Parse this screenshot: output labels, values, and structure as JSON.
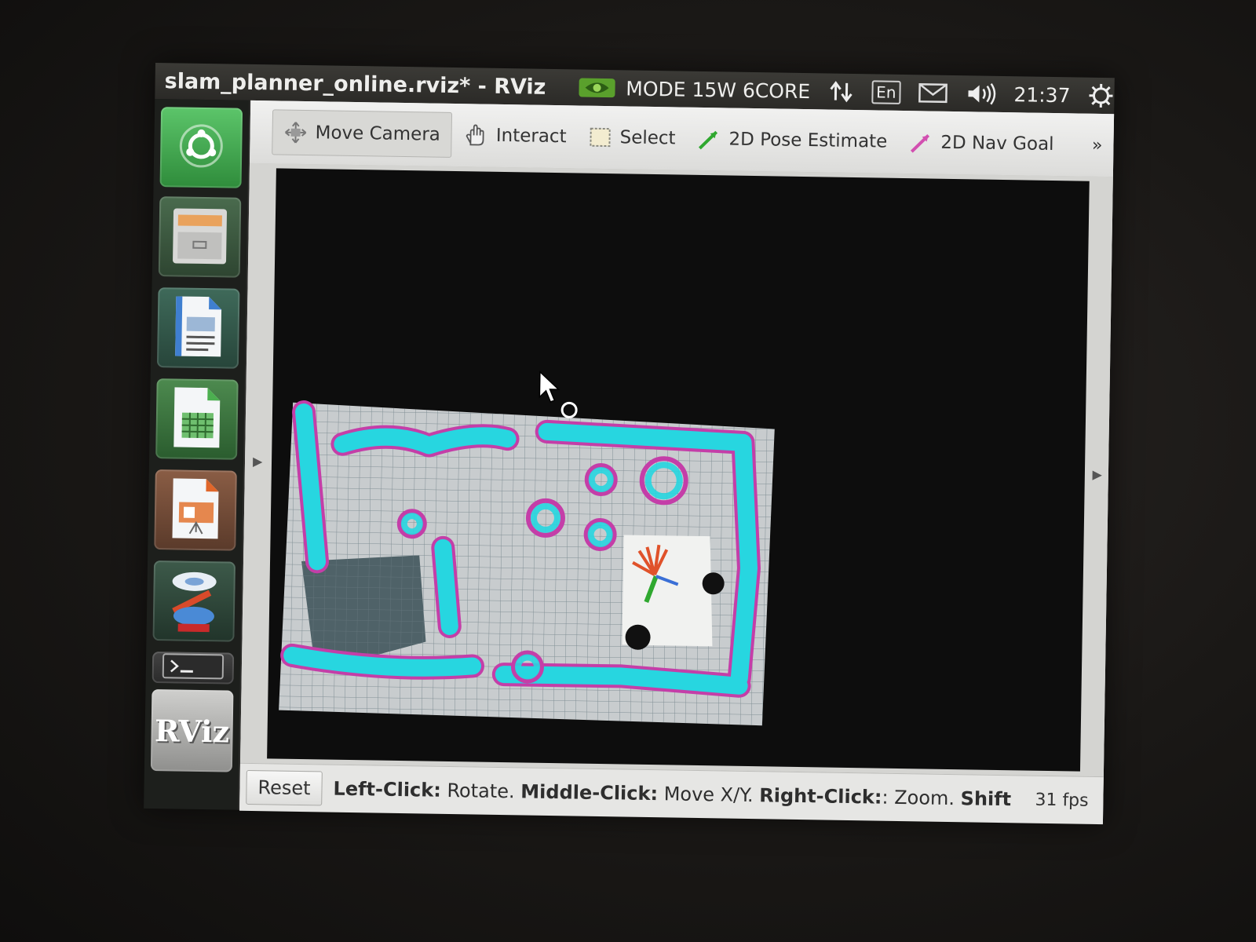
{
  "top_panel": {
    "window_title": "slam_planner_online.rviz* - RViz",
    "power_mode": "MODE 15W 6CORE",
    "keyboard_layout": "En",
    "clock": "21:37",
    "icons": [
      "nvidia-logo-icon",
      "network-arrows-icon",
      "mail-icon",
      "volume-icon",
      "power-gear-icon"
    ]
  },
  "launcher": {
    "items": [
      {
        "name": "dash-home",
        "icon": "ubuntu-logo-icon"
      },
      {
        "name": "files",
        "icon": "file-cabinet-icon"
      },
      {
        "name": "writer",
        "icon": "writer-document-icon"
      },
      {
        "name": "calc",
        "icon": "calc-spreadsheet-icon"
      },
      {
        "name": "impress",
        "icon": "impress-presentation-icon"
      },
      {
        "name": "software-center",
        "icon": "stacked-app-icon"
      },
      {
        "name": "terminal",
        "icon": "terminal-icon"
      },
      {
        "name": "rviz",
        "label": "RViz",
        "icon": "rviz-icon"
      }
    ]
  },
  "toolbar": {
    "tools": [
      {
        "label": "Move Camera",
        "icon": "move-camera-icon",
        "active": true
      },
      {
        "label": "Interact",
        "icon": "hand-icon"
      },
      {
        "label": "Select",
        "icon": "select-box-icon"
      },
      {
        "label": "2D Pose Estimate",
        "icon": "green-arrow-icon",
        "color": "#2fa82f"
      },
      {
        "label": "2D Nav Goal",
        "icon": "pink-arrow-icon",
        "color": "#d24fb0"
      }
    ],
    "overflow": "»"
  },
  "status_bar": {
    "reset_label": "Reset",
    "hint_left_click_key": "Left-Click:",
    "hint_left_click_action": " Rotate. ",
    "hint_middle_click_key": "Middle-Click:",
    "hint_middle_click_action": " Move X/Y. ",
    "hint_right_click_key": "Right-Click:",
    "hint_right_click_action": ": Zoom. ",
    "hint_shift_key": "Shift",
    "fps": "31 fps"
  },
  "colors": {
    "costmap_inflation": "#27d6e0",
    "costmap_lethal": "#c43ea8",
    "map_free": "#c8ccce",
    "viewport_bg": "#0d0d0d"
  }
}
